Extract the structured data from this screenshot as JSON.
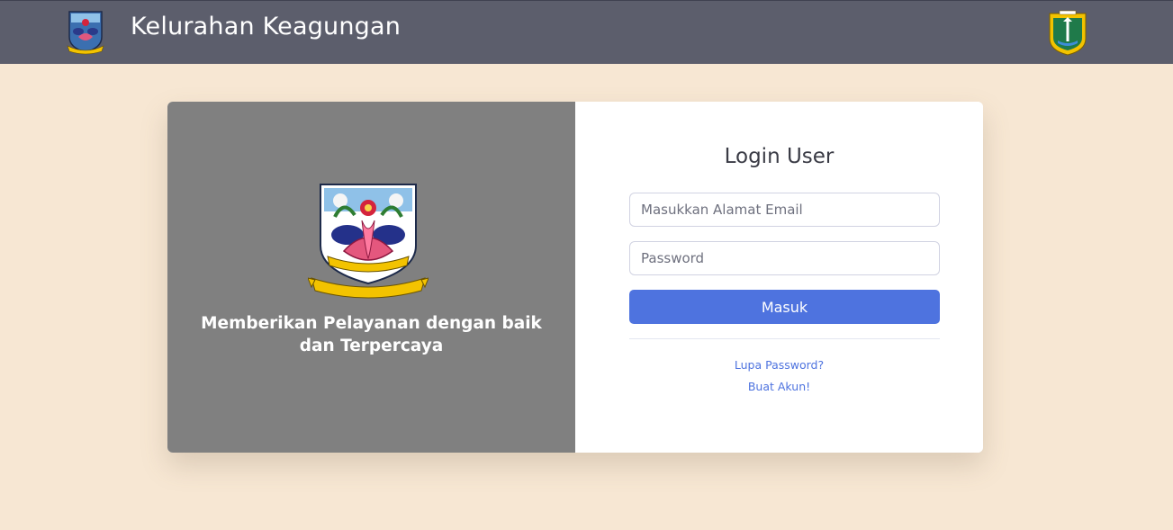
{
  "header": {
    "title": "Kelurahan Keagungan",
    "left_logo": "jakarta-barat-emblem-icon",
    "right_logo": "dki-jakarta-emblem-icon",
    "background_color": "#5c5e6c"
  },
  "hero": {
    "emblem": "jakarta-barat-emblem-icon",
    "tagline": "Memberikan Pelayanan dengan baik dan Terpercaya",
    "background_color": "#808080"
  },
  "login": {
    "title": "Login User",
    "email_placeholder": "Masukkan Alamat Email",
    "password_placeholder": "Password",
    "submit_label": "Masuk",
    "forgot_link": "Lupa Password?",
    "register_link": "Buat Akun!",
    "accent_color": "#4e73df"
  },
  "page": {
    "background_color": "#f7e7d3"
  }
}
